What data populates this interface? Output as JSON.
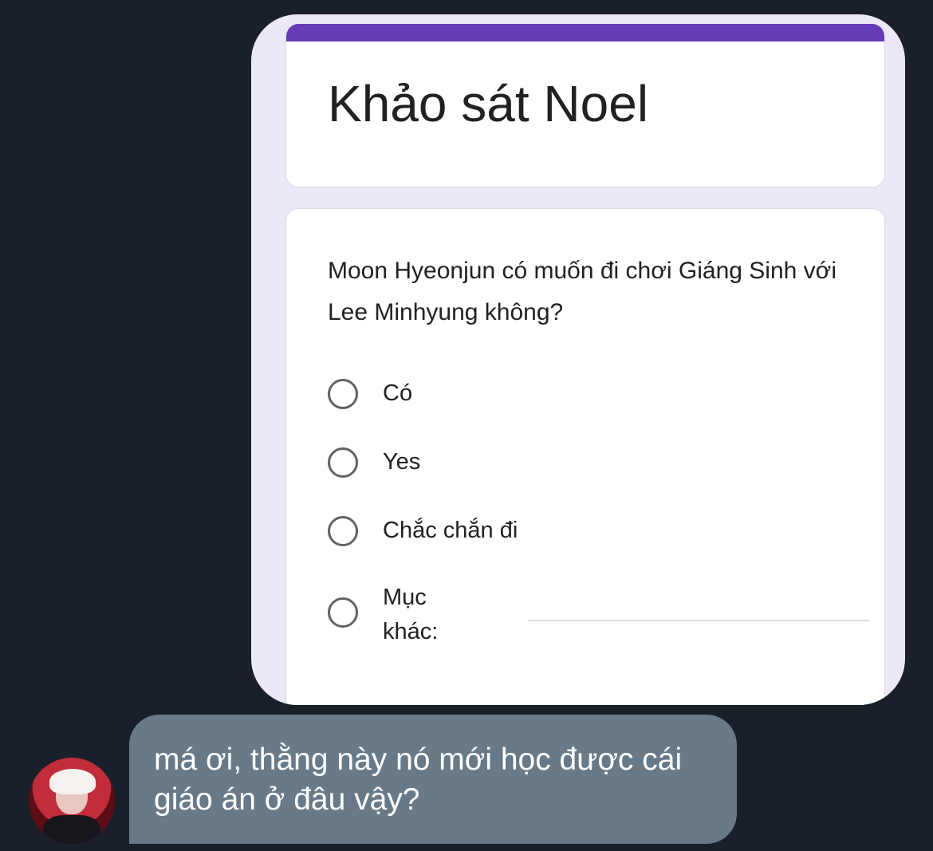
{
  "form": {
    "title": "Khảo sát Noel",
    "accent_color": "#673ab7",
    "question": "Moon Hyeonjun có muốn đi chơi Giáng Sinh với Lee Minhyung không?",
    "options": [
      {
        "label": "Có"
      },
      {
        "label": "Yes"
      },
      {
        "label": "Chắc chắn đi"
      }
    ],
    "other_label": "Mục khác:"
  },
  "message": {
    "text": "má ơi, thằng này nó mới học được cái giáo án ở đâu vậy?",
    "bubble_color": "#687988"
  },
  "avatar": {
    "icon": "user-avatar"
  }
}
